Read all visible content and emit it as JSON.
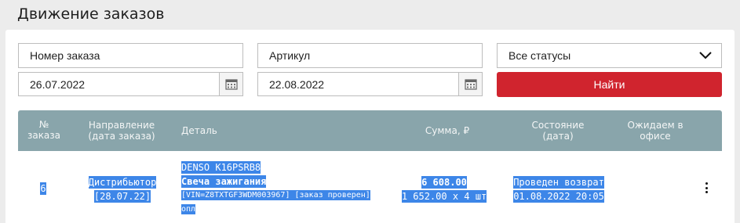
{
  "page": {
    "title": "Движение заказов"
  },
  "filters": {
    "order_number_placeholder": "Номер заказа",
    "article_placeholder": "Артикул",
    "status_selected": "Все статусы",
    "date_from": "26.07.2022",
    "date_to": "22.08.2022",
    "search_label": "Найти"
  },
  "table": {
    "headers": {
      "number": [
        "№",
        "заказа"
      ],
      "direction": [
        "Направление",
        "(дата заказа)"
      ],
      "detail": "Деталь",
      "sum": "Сумма, ₽",
      "state": [
        "Состояние",
        "(дата)"
      ],
      "expected": [
        "Ожидаем в",
        "офисе"
      ]
    },
    "rows": [
      {
        "number": "6",
        "direction": "Дистрибьютор",
        "order_date": "[28.07.22]",
        "brand_code": "DENSO  K16PSRB8",
        "detail_name": "Свеча зажигания",
        "detail_note_1": "[VIN=Z8TXTGF3WDM003967] [заказ проверен]",
        "detail_note_2": "опл",
        "sum_total": "6 608.00",
        "sum_breakdown": "1 652.00 х 4 шт",
        "state": "Проведен возврат",
        "state_date": "01.08.2022 20:05",
        "expected": ""
      }
    ]
  },
  "icons": {
    "calendar": "calendar-icon",
    "dropdown": "chevron-down-icon",
    "menu": "kebab-menu-icon"
  },
  "colors": {
    "accent": "#d0242e",
    "header": "#89a5ab",
    "selection": "#3d86e8"
  }
}
